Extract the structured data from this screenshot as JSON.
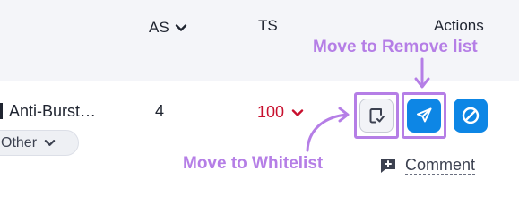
{
  "table": {
    "columns": {
      "as": "AS",
      "ts": "TS",
      "actions": "Actions"
    },
    "row": {
      "name": "Anti-Burst…",
      "tag": "Other",
      "as_value": "4",
      "ts_value": "100",
      "comment_label": "Comment"
    }
  },
  "icons": {
    "as_sort": "chevron-down-icon",
    "tag_dropdown": "chevron-down-icon",
    "ts_dropdown": "chevron-down-icon",
    "whitelist": "document-check-icon",
    "remove_list": "send-icon",
    "block": "block-icon",
    "comment": "comment-add-icon"
  },
  "annotations": {
    "remove": "Move to Remove list",
    "whitelist": "Move to Whitelist"
  },
  "colors": {
    "accent_blue": "#0d86e5",
    "ts_red": "#c8102e",
    "annotation_purple": "#b57ee6",
    "header_bg": "#f4f5f9"
  }
}
